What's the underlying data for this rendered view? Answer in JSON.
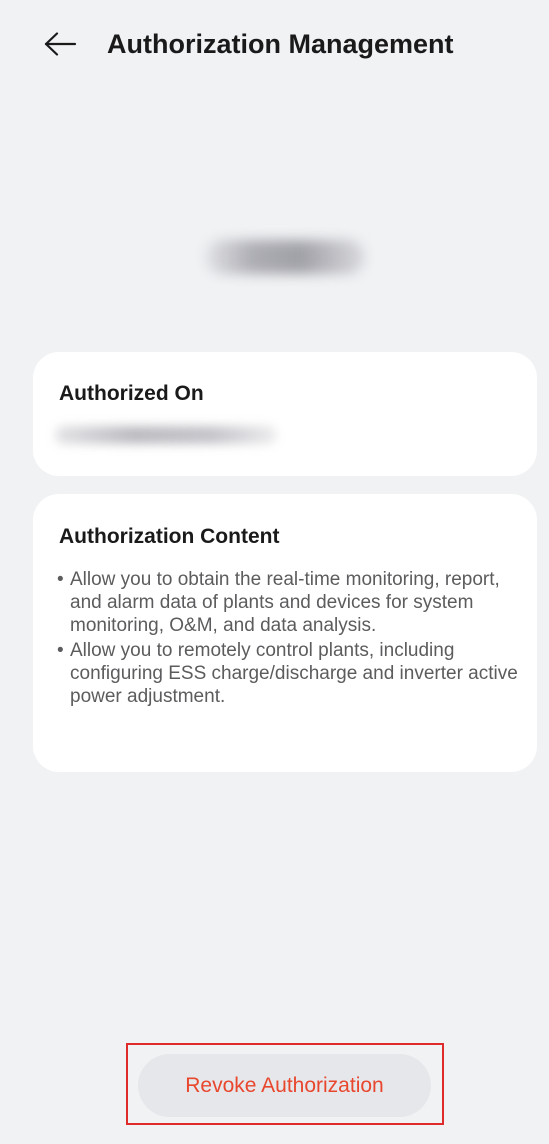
{
  "header": {
    "back_icon": "arrow-left-icon",
    "title": "Authorization Management"
  },
  "account": {
    "name": "",
    "redacted": true
  },
  "authorized_on": {
    "title": "Authorized On",
    "value": "",
    "redacted": true
  },
  "authorization_content": {
    "title": "Authorization Content",
    "items": [
      {
        "bullet": "•",
        "text": "Allow you to obtain the real-time monitoring, report, and alarm data of plants and devices for system monitoring, O&M, and data analysis."
      },
      {
        "bullet": "•",
        "text": "Allow you to remotely control plants, including configuring ESS charge/discharge and inverter active power adjustment."
      }
    ]
  },
  "actions": {
    "revoke_label": "Revoke Authorization"
  },
  "colors": {
    "background": "#f1f2f4",
    "card": "#ffffff",
    "revoke_text": "#e8472e",
    "revoke_button_bg": "#e6e7ea",
    "highlight_outline": "#e02b2b"
  }
}
